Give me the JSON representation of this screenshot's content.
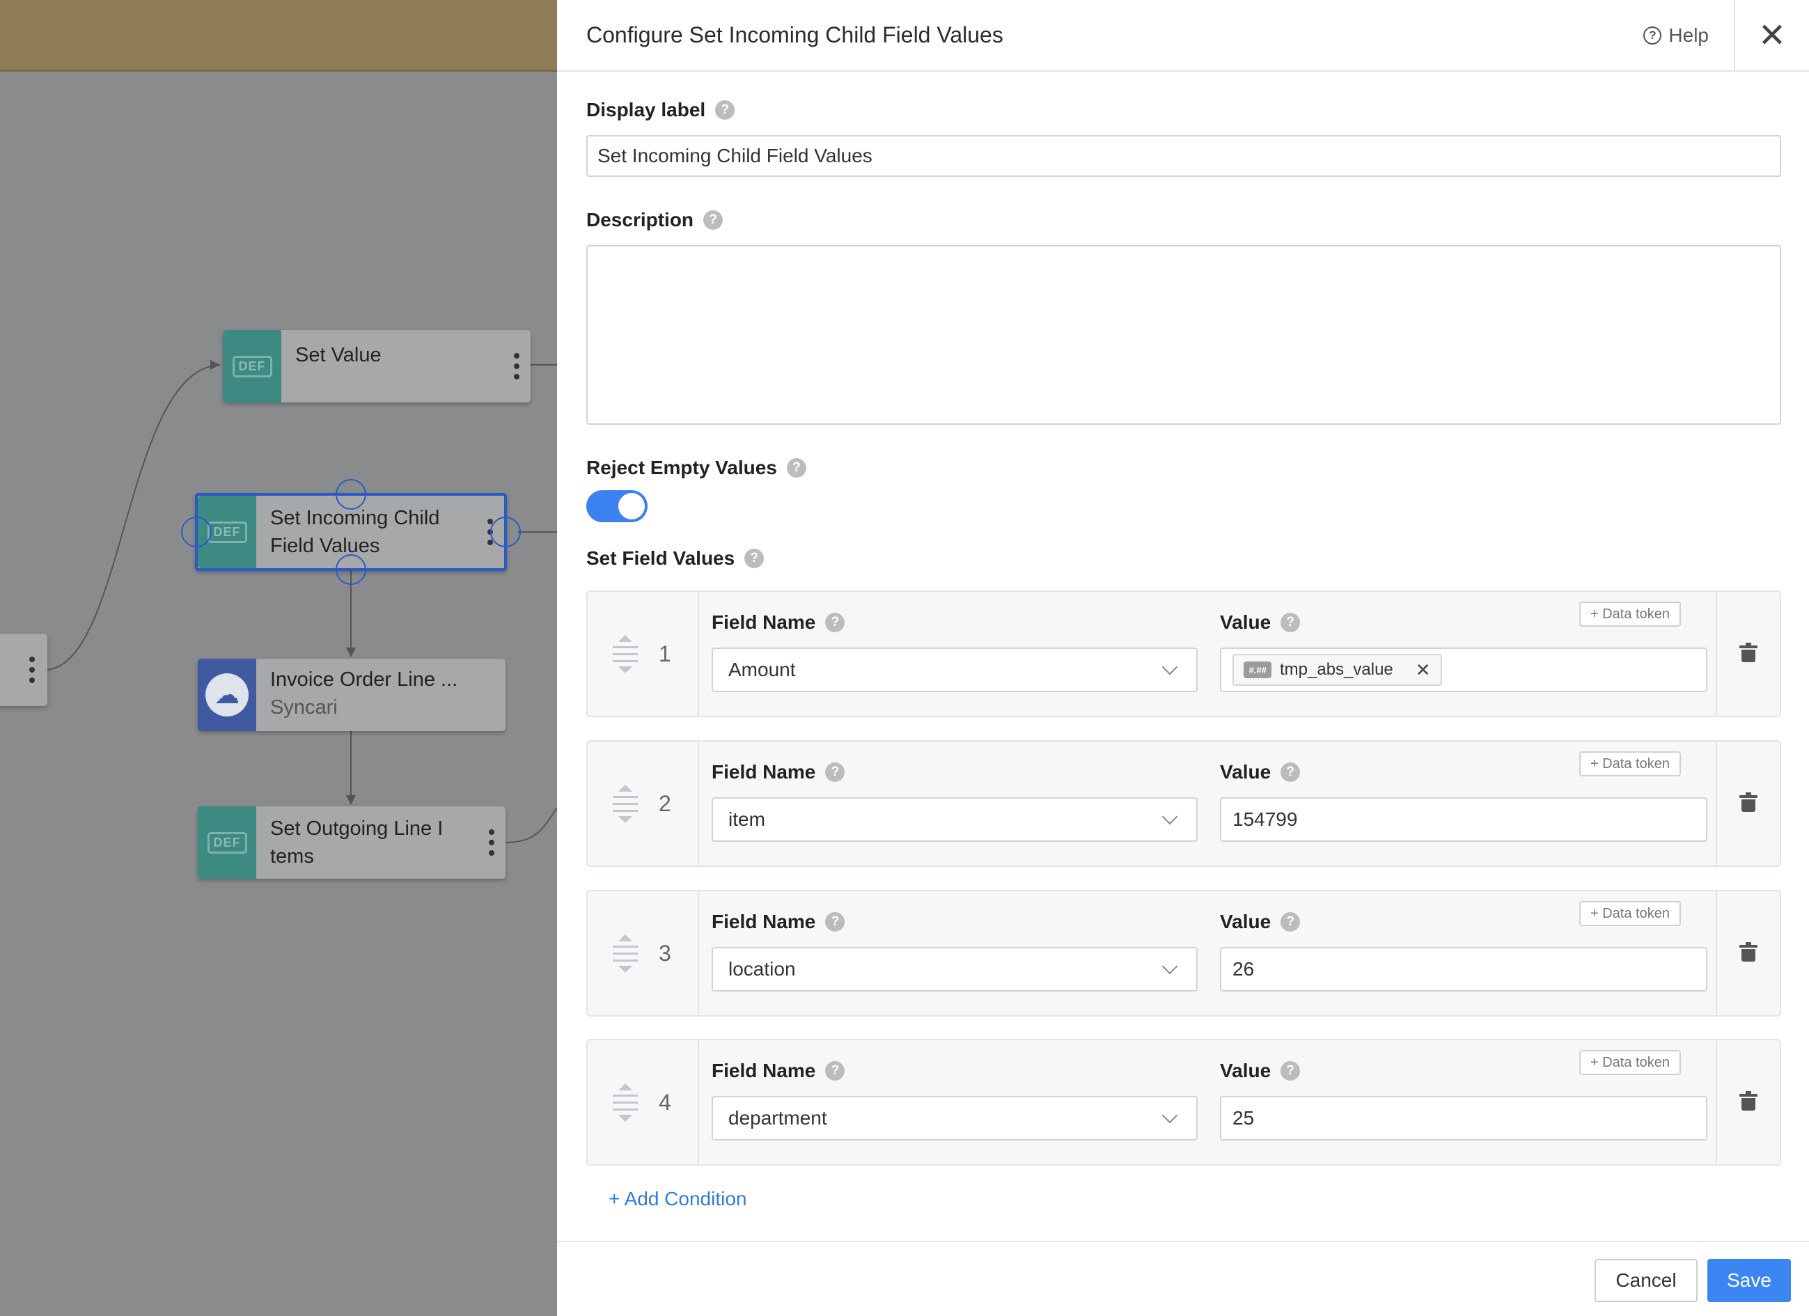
{
  "canvas": {
    "nodes": [
      {
        "title": "Set Value",
        "subtitle": "",
        "badge": "DEF"
      },
      {
        "title": "Set Incoming Child Field Values",
        "subtitle": "",
        "badge": "DEF"
      },
      {
        "title": "Invoice Order Line ...",
        "subtitle": "Syncari",
        "badge": "cloud-icon"
      },
      {
        "title": "Set Outgoing Line I tems",
        "subtitle": "",
        "badge": "DEF"
      }
    ]
  },
  "panel": {
    "title": "Configure Set Incoming Child Field Values",
    "help_label": "Help",
    "display_label": {
      "label": "Display label",
      "value": "Set Incoming Child Field Values"
    },
    "description": {
      "label": "Description",
      "value": ""
    },
    "reject_empty": {
      "label": "Reject Empty Values",
      "enabled": true
    },
    "set_field_values": {
      "label": "Set Field Values",
      "field_name_label": "Field Name",
      "value_label": "Value",
      "data_token_label": "+ Data token",
      "rows": [
        {
          "num": "1",
          "field": "Amount",
          "value": "",
          "token": "tmp_abs_value",
          "token_icon": "#.##"
        },
        {
          "num": "2",
          "field": "item",
          "value": "154799",
          "token": ""
        },
        {
          "num": "3",
          "field": "location",
          "value": "26",
          "token": ""
        },
        {
          "num": "4",
          "field": "department",
          "value": "25",
          "token": ""
        }
      ]
    },
    "add_condition_label": "+ Add Condition",
    "cancel_label": "Cancel",
    "save_label": "Save"
  },
  "colors": {
    "accent": "#3b86f3",
    "toggle_on": "#3b82f0",
    "node_def": "#3c8a82",
    "node_cloud": "#3f5aa1",
    "selection": "#2a5ac4"
  }
}
